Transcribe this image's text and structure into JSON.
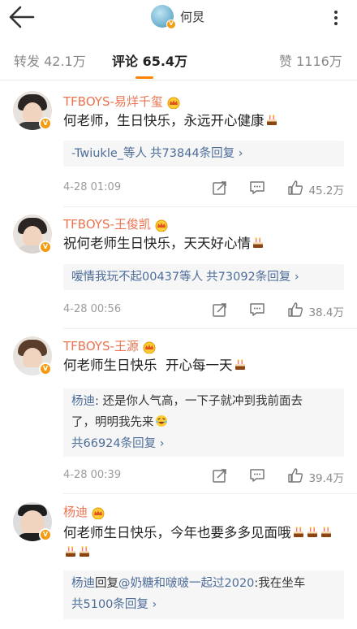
{
  "nav": {
    "back_icon": "arrow-left-icon",
    "title": "何炅",
    "more_icon": "more-dots-icon"
  },
  "tabs": [
    {
      "label": "转发 42.1万",
      "active": false
    },
    {
      "label": "评论 65.4万",
      "active": true
    },
    {
      "label": "赞 1116万",
      "active": false
    }
  ],
  "colors": {
    "accent": "#ff8200",
    "username": "#eb7350",
    "link": "#4d6d9a",
    "verified": "#f39c12"
  },
  "comments": [
    {
      "username": "TFBOYS-易烊千玺",
      "text": "何老师，生日快乐，永远开心健康",
      "reply_lines": [
        {
          "prefix": "-Twiukle_等人",
          "link": "共73844条回复 ›"
        }
      ],
      "time": "4-28 01:09",
      "likes": "45.2万"
    },
    {
      "username": "TFBOYS-王俊凯",
      "text": "祝何老师生日快乐，天天好心情",
      "reply_lines": [
        {
          "prefix": "嗳情我玩不起00437等人",
          "link": "共73092条回复 ›"
        }
      ],
      "time": "4-28 00:56",
      "likes": "38.4万"
    },
    {
      "username": "TFBOYS-王源",
      "text": "何老师生日快乐  开心每一天",
      "reply_lines": [
        {
          "name": "杨迪",
          "content": ": 还是你人气高，一下子就冲到我前面去"
        },
        {
          "content": "了，明明我先来"
        },
        {
          "link": "共66924条回复 ›"
        }
      ],
      "time": "4-28 00:39",
      "likes": "39.4万"
    },
    {
      "username": "杨迪",
      "text_line1": "何老师生日快乐，今年也要多多见面哦",
      "reply_lines": [
        {
          "name": "杨迪",
          "mid": "回复",
          "mention": "@奶糖和啵啵一起过2020",
          "content": ":我在坐车"
        },
        {
          "link": "共5100条回复 ›"
        }
      ]
    }
  ],
  "icons": {
    "share": "share-icon",
    "comment": "comment-icon",
    "like": "thumbs-up-icon",
    "cake": "cake-emoji-icon",
    "laugh": "laugh-cry-emoji-icon",
    "crown": "crown-badge-icon",
    "verified": "verified-v-badge"
  }
}
